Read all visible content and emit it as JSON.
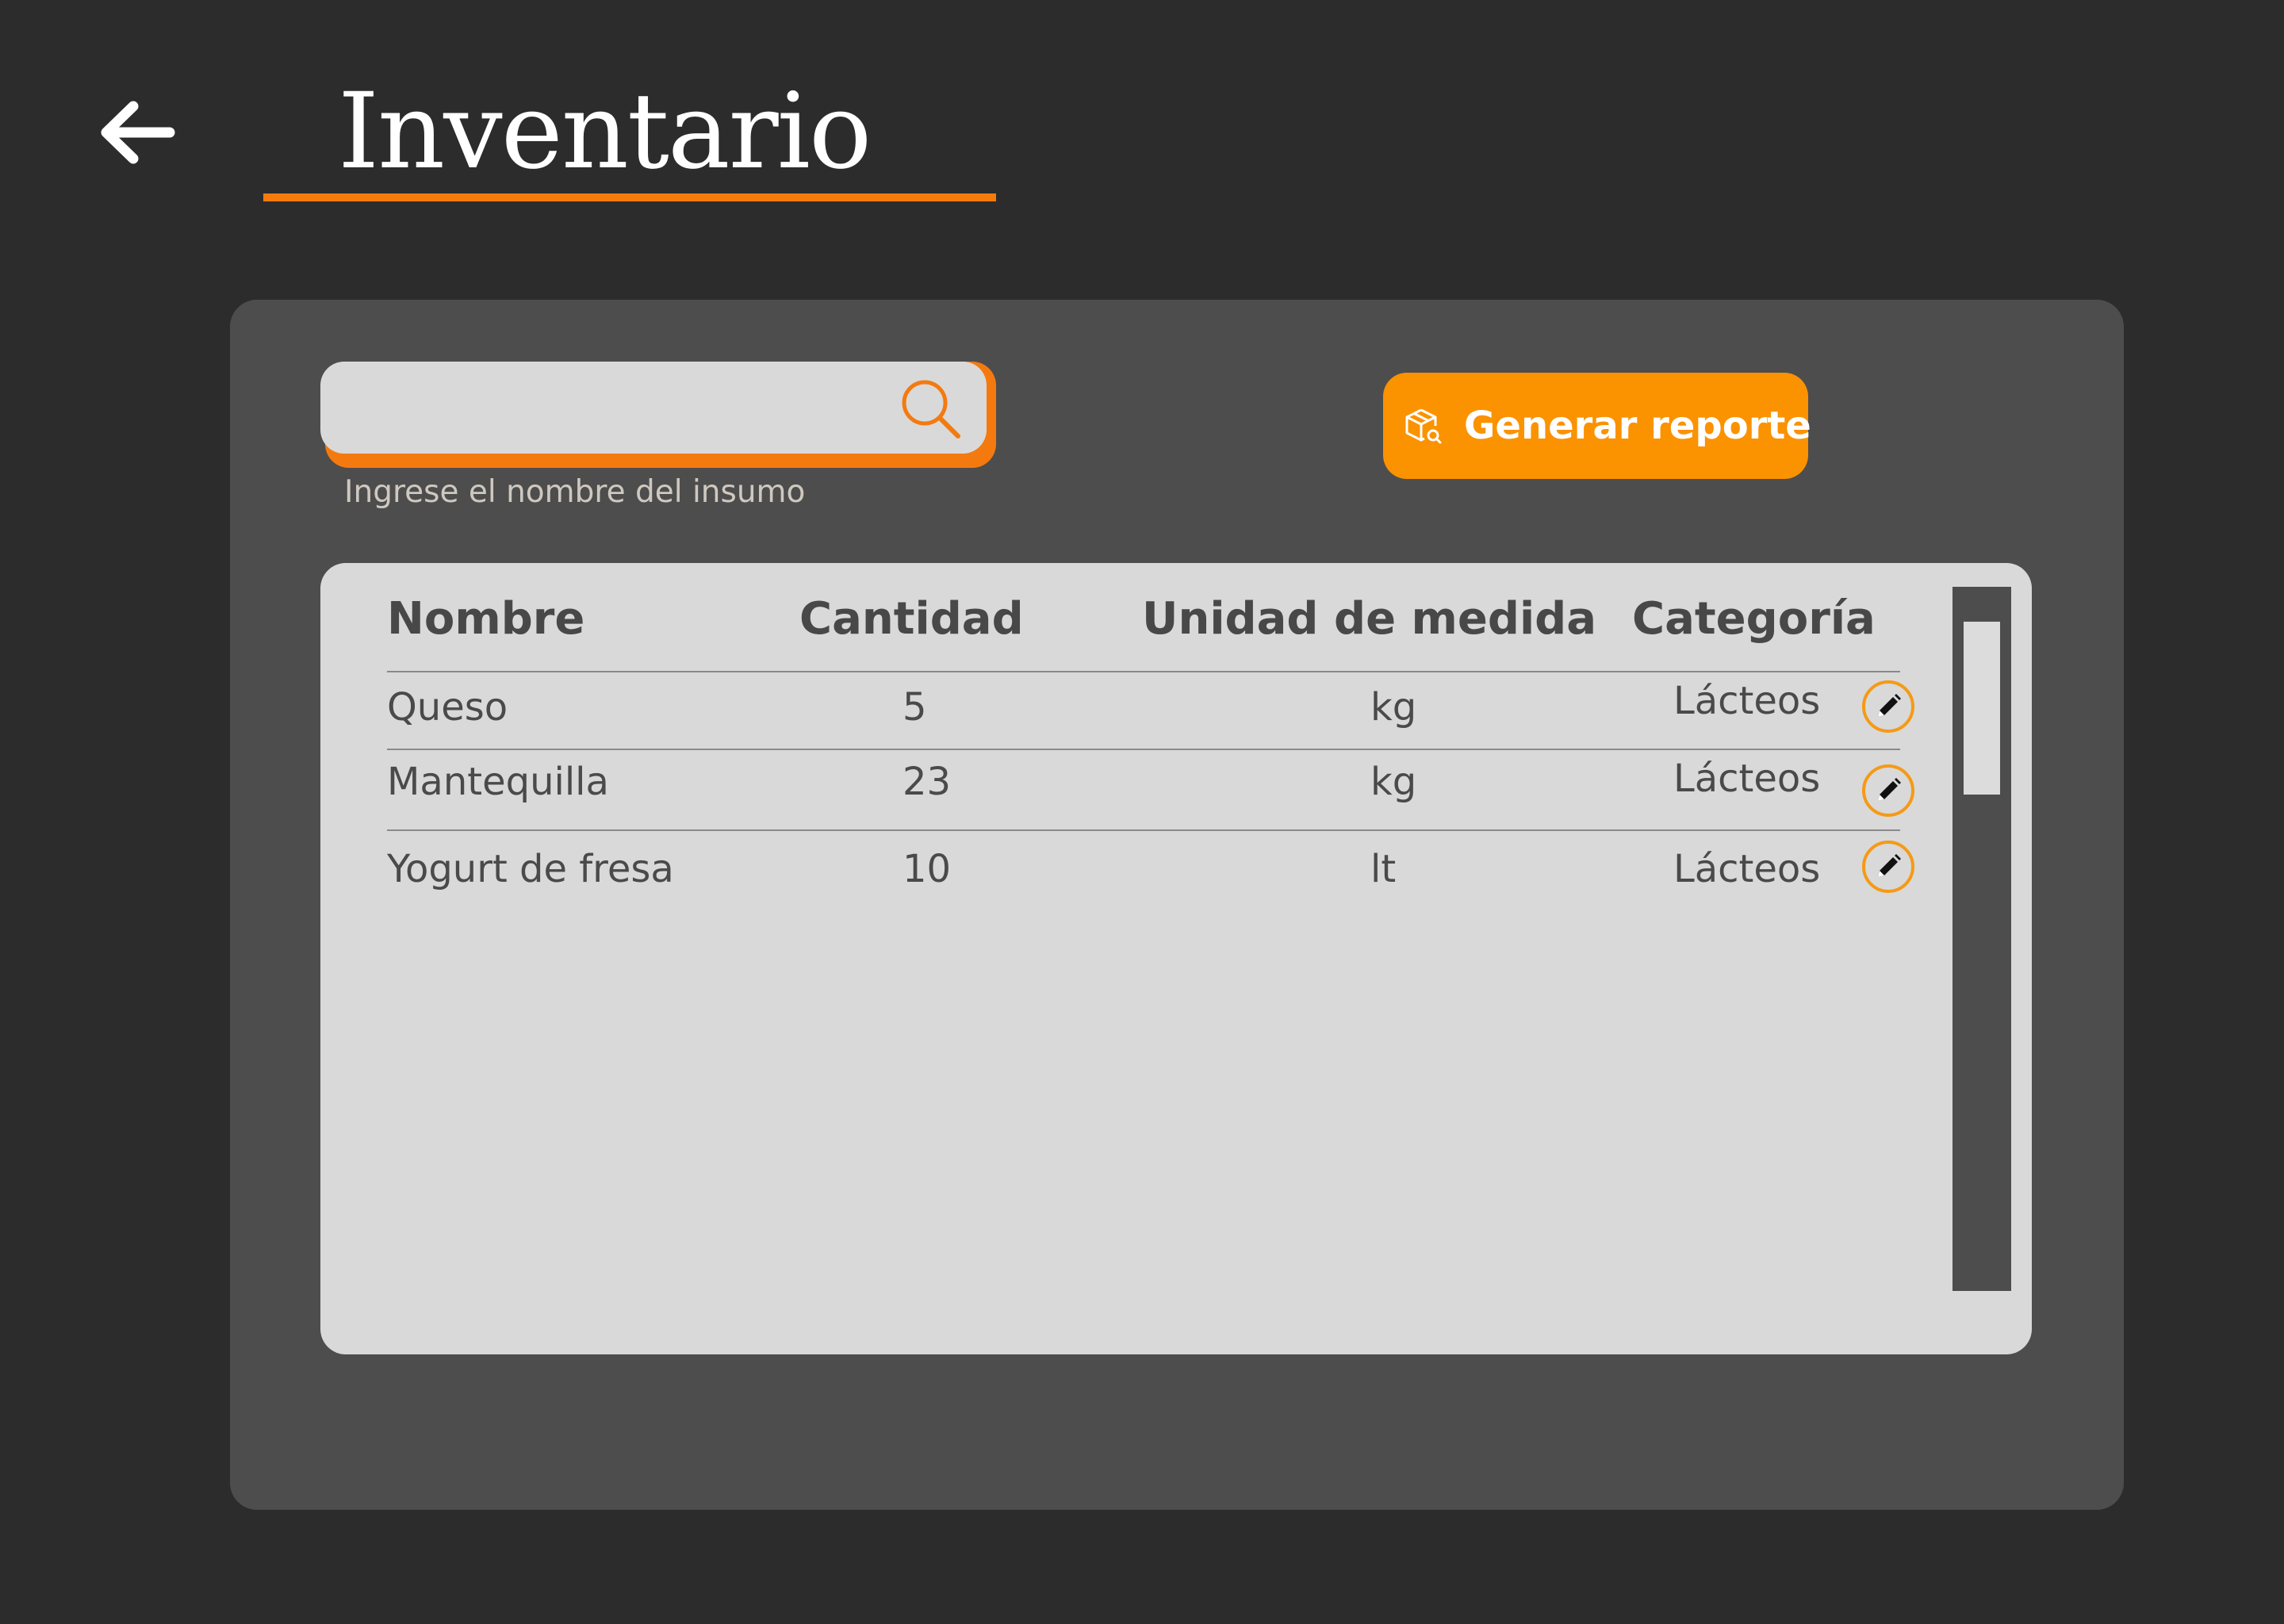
{
  "header": {
    "title": "Inventario",
    "back_icon": "arrow-left-icon"
  },
  "search": {
    "value": "",
    "placeholder": "",
    "hint": "Ingrese el nombre del insumo",
    "icon": "search-icon"
  },
  "actions": {
    "report_label": "Generar reporte",
    "report_icon": "package-search-icon"
  },
  "table": {
    "columns": [
      "Nombre",
      "Cantidad",
      "Unidad de medida",
      "Categoría"
    ],
    "rows": [
      {
        "nombre": "Queso",
        "cantidad": "5",
        "unidad": "kg",
        "categoria": "Lácteos"
      },
      {
        "nombre": "Mantequilla",
        "cantidad": "23",
        "unidad": "kg",
        "categoria": "Lácteos"
      },
      {
        "nombre": "Yogurt de fresa",
        "cantidad": "10",
        "unidad": "lt",
        "categoria": "Lácteos"
      }
    ],
    "row_action_icon": "pencil-icon"
  },
  "colors": {
    "background": "#2c2c2c",
    "panel": "#4d4d4d",
    "card": "#d9d9d9",
    "accent": "#fb9200",
    "accent_dark": "#f47a10",
    "text_dark": "#484848"
  }
}
